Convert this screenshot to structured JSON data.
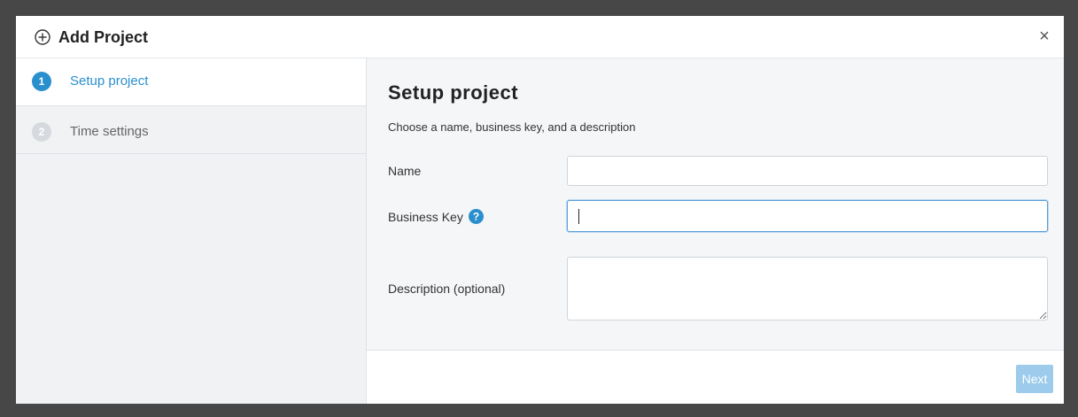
{
  "modal": {
    "title": "Add Project",
    "close_label": "×"
  },
  "steps": [
    {
      "number": "1",
      "label": "Setup project",
      "active": true
    },
    {
      "number": "2",
      "label": "Time settings",
      "active": false
    }
  ],
  "content": {
    "title": "Setup project",
    "subtitle": "Choose a name, business key, and a description",
    "fields": {
      "name": {
        "label": "Name",
        "value": "",
        "placeholder": ""
      },
      "business_key": {
        "label": "Business Key",
        "value": "",
        "placeholder": "",
        "help_icon": "question-circle-icon"
      },
      "description": {
        "label": "Description (optional)",
        "value": "",
        "placeholder": ""
      }
    }
  },
  "footer": {
    "next_label": "Next"
  },
  "colors": {
    "accent": "#2a8fcd",
    "next_button_disabled": "#9ccbeb",
    "backdrop": "#474747"
  }
}
